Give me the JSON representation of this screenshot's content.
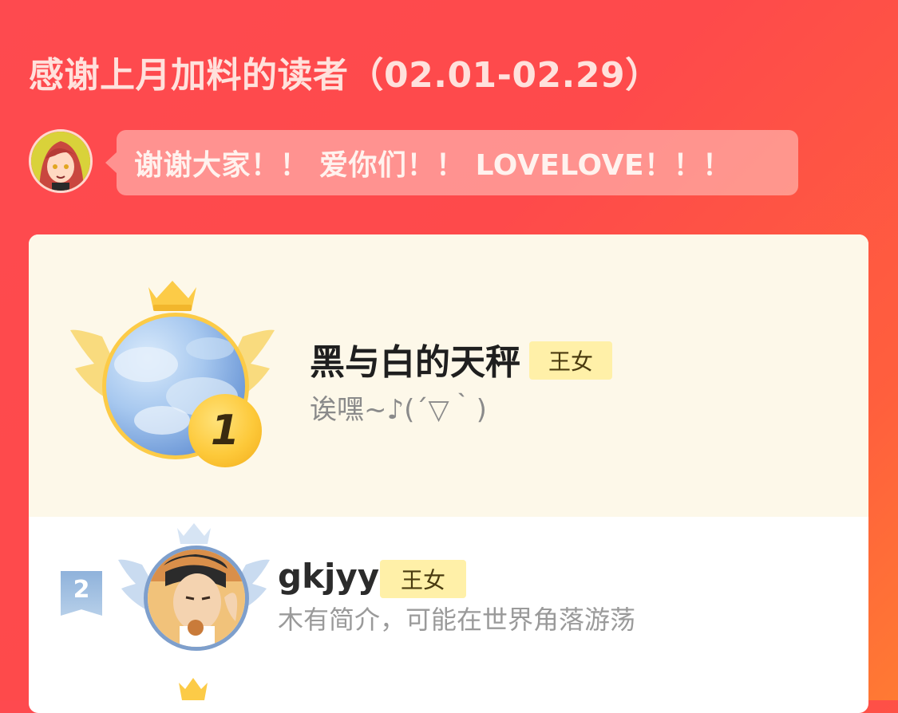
{
  "header": {
    "title": "感谢上月加料的读者（02.01-02.29）"
  },
  "author_message": {
    "text": "谢谢大家！！ 爱你们！！ LOVELOVE！！！"
  },
  "ranking": [
    {
      "rank": "1",
      "name": "黑与白的天秤",
      "tag": "王女",
      "bio": "诶嘿~♪(´▽｀)"
    },
    {
      "rank": "2",
      "name": "gkjyy",
      "tag": "王女",
      "bio": "木有简介，可能在世界角落游荡"
    }
  ],
  "colors": {
    "background": "#fe4a4f",
    "gold": "#fccb47",
    "silver_blue": "#7e9fcc",
    "tag_bg": "#fff0a8",
    "card_top_bg": "#fdf8e9"
  },
  "icons": {
    "rank1": "gold-winged-crown-icon",
    "rank2": "silver-winged-crown-icon",
    "rank3": "crown-icon"
  }
}
